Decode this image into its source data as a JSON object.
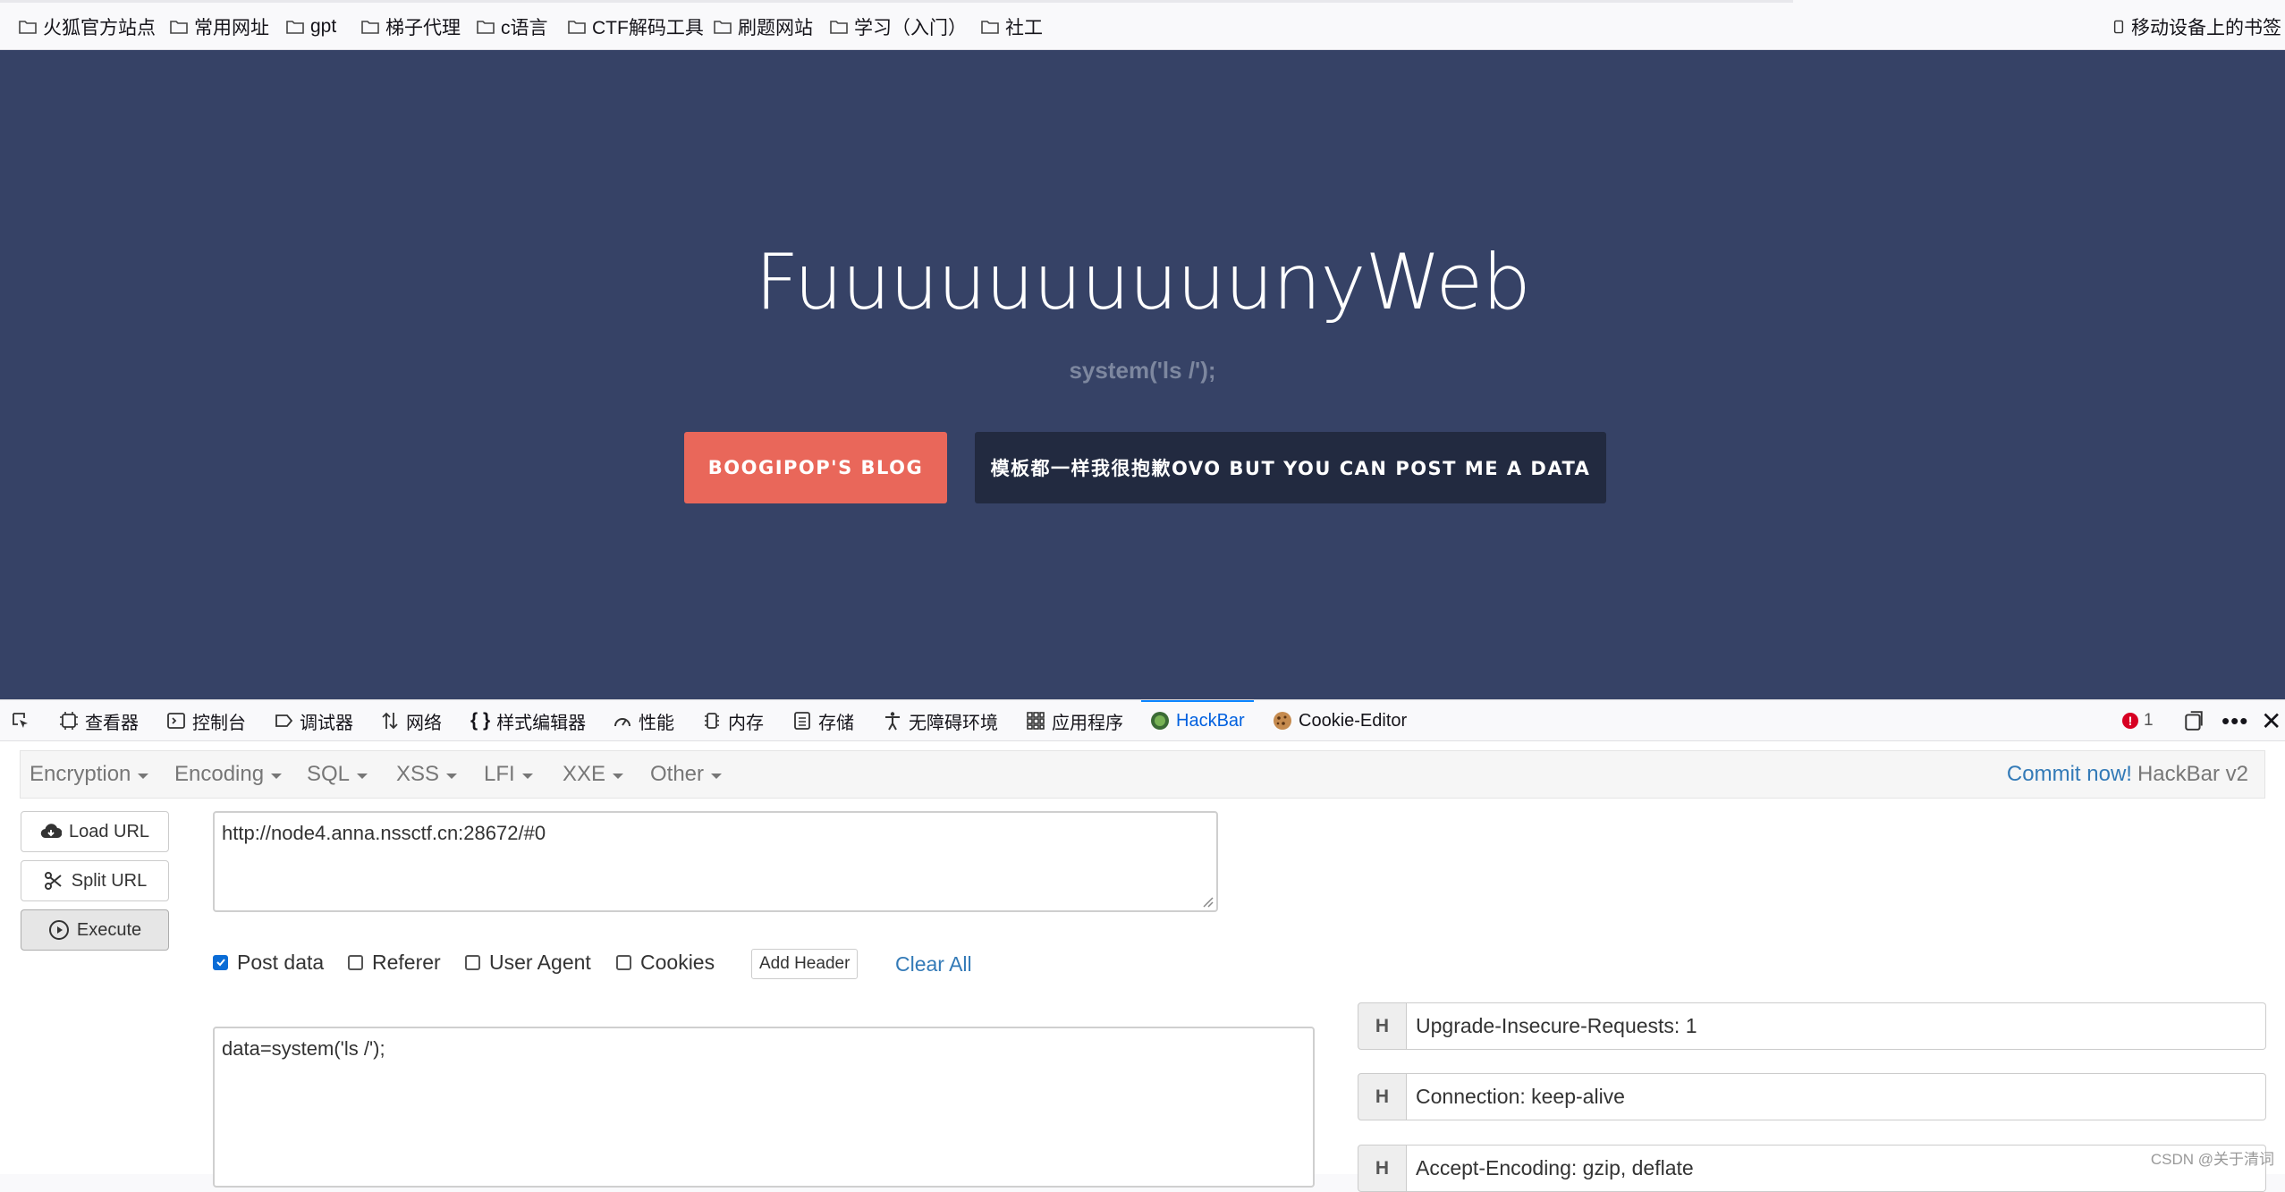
{
  "bookmarks": {
    "items": [
      "火狐官方站点",
      "常用网址",
      "gpt",
      "梯子代理",
      "c语言",
      "CTF解码工具",
      "刷题网站",
      "学习（入门）",
      "社工"
    ],
    "mobile": "移动设备上的书签"
  },
  "page": {
    "title": "FuuuuuuuuuunyWeb",
    "subtitle": "system('ls /');",
    "blog_button": "BOOGIPOP'S BLOG",
    "post_button": "模板都一样我很抱歉OVO BUT YOU CAN POST ME A DATA",
    "background": "#364266"
  },
  "devtools": {
    "tabs": [
      "查看器",
      "控制台",
      "调试器",
      "网络",
      "样式编辑器",
      "性能",
      "内存",
      "存储",
      "无障碍环境",
      "应用程序",
      "HackBar",
      "Cookie-Editor"
    ],
    "active_tab": "HackBar",
    "error_count": "1"
  },
  "hackbar": {
    "menu": [
      "Encryption",
      "Encoding",
      "SQL",
      "XSS",
      "LFI",
      "XXE",
      "Other"
    ],
    "commit_link": "Commit now!",
    "version": "HackBar v2",
    "load_url": "Load URL",
    "split_url": "Split URL",
    "execute": "Execute",
    "url": "http://node4.anna.nssctf.cn:28672/#0",
    "options": {
      "post_data": "Post data",
      "referer": "Referer",
      "user_agent": "User Agent",
      "cookies": "Cookies"
    },
    "add_header": "Add Header",
    "clear_all": "Clear All",
    "post_body": "data=system('ls /');",
    "headers": [
      {
        "label": "H",
        "value": "Upgrade-Insecure-Requests: 1"
      },
      {
        "label": "H",
        "value": "Connection: keep-alive"
      },
      {
        "label": "H",
        "value": "Accept-Encoding: gzip, deflate"
      }
    ]
  },
  "watermark": "CSDN @关于清词"
}
